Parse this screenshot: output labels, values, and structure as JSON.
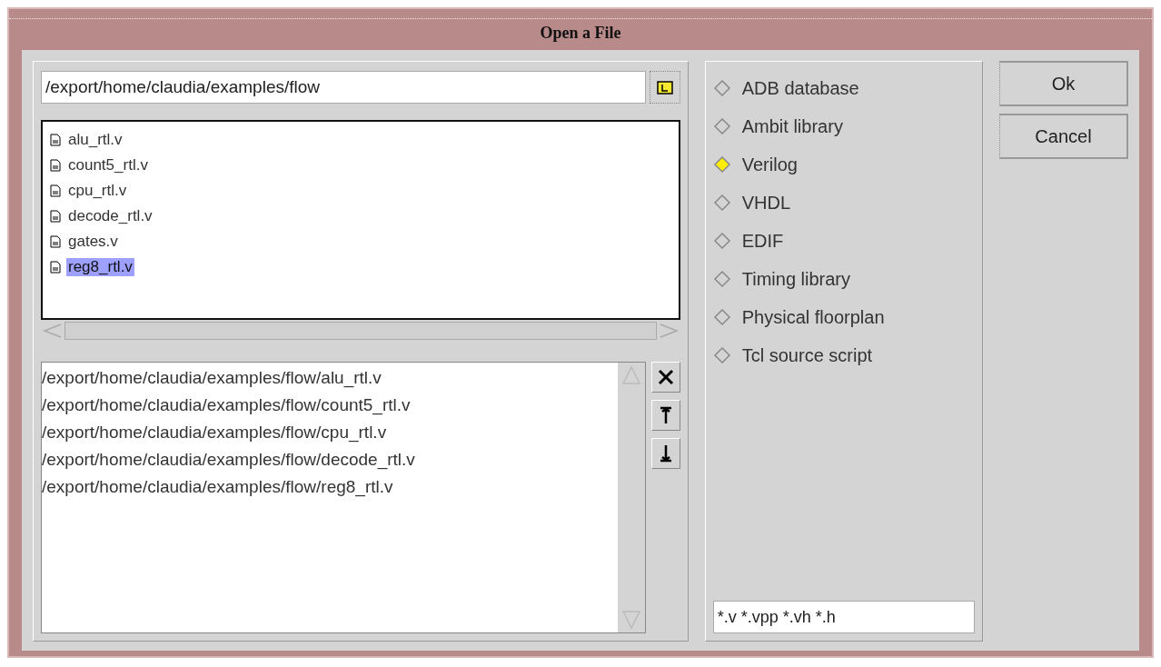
{
  "window": {
    "title": "Open a File"
  },
  "path_field": {
    "value": "/export/home/claudia/examples/flow"
  },
  "files": [
    {
      "name": "alu_rtl.v",
      "selected": false
    },
    {
      "name": "count5_rtl.v",
      "selected": false
    },
    {
      "name": "cpu_rtl.v",
      "selected": false
    },
    {
      "name": "decode_rtl.v",
      "selected": false
    },
    {
      "name": "gates.v",
      "selected": false
    },
    {
      "name": "reg8_rtl.v",
      "selected": true
    }
  ],
  "chosen_files": [
    "/export/home/claudia/examples/flow/alu_rtl.v",
    "/export/home/claudia/examples/flow/count5_rtl.v",
    "/export/home/claudia/examples/flow/cpu_rtl.v",
    "/export/home/claudia/examples/flow/decode_rtl.v",
    "/export/home/claudia/examples/flow/reg8_rtl.v"
  ],
  "list_tools": [
    {
      "kind": "remove"
    },
    {
      "kind": "top"
    },
    {
      "kind": "bottom"
    }
  ],
  "formats": [
    {
      "label": "ADB database",
      "selected": false
    },
    {
      "label": "Ambit library",
      "selected": false
    },
    {
      "label": "Verilog",
      "selected": true
    },
    {
      "label": "VHDL",
      "selected": false
    },
    {
      "label": "EDIF",
      "selected": false
    },
    {
      "label": "Timing library",
      "selected": false
    },
    {
      "label": "Physical floorplan",
      "selected": false
    },
    {
      "label": "Tcl source script",
      "selected": false
    }
  ],
  "filter_field": {
    "value": "*.v *.vpp *.vh *.h"
  },
  "buttons": [
    "Ok",
    "Cancel"
  ]
}
